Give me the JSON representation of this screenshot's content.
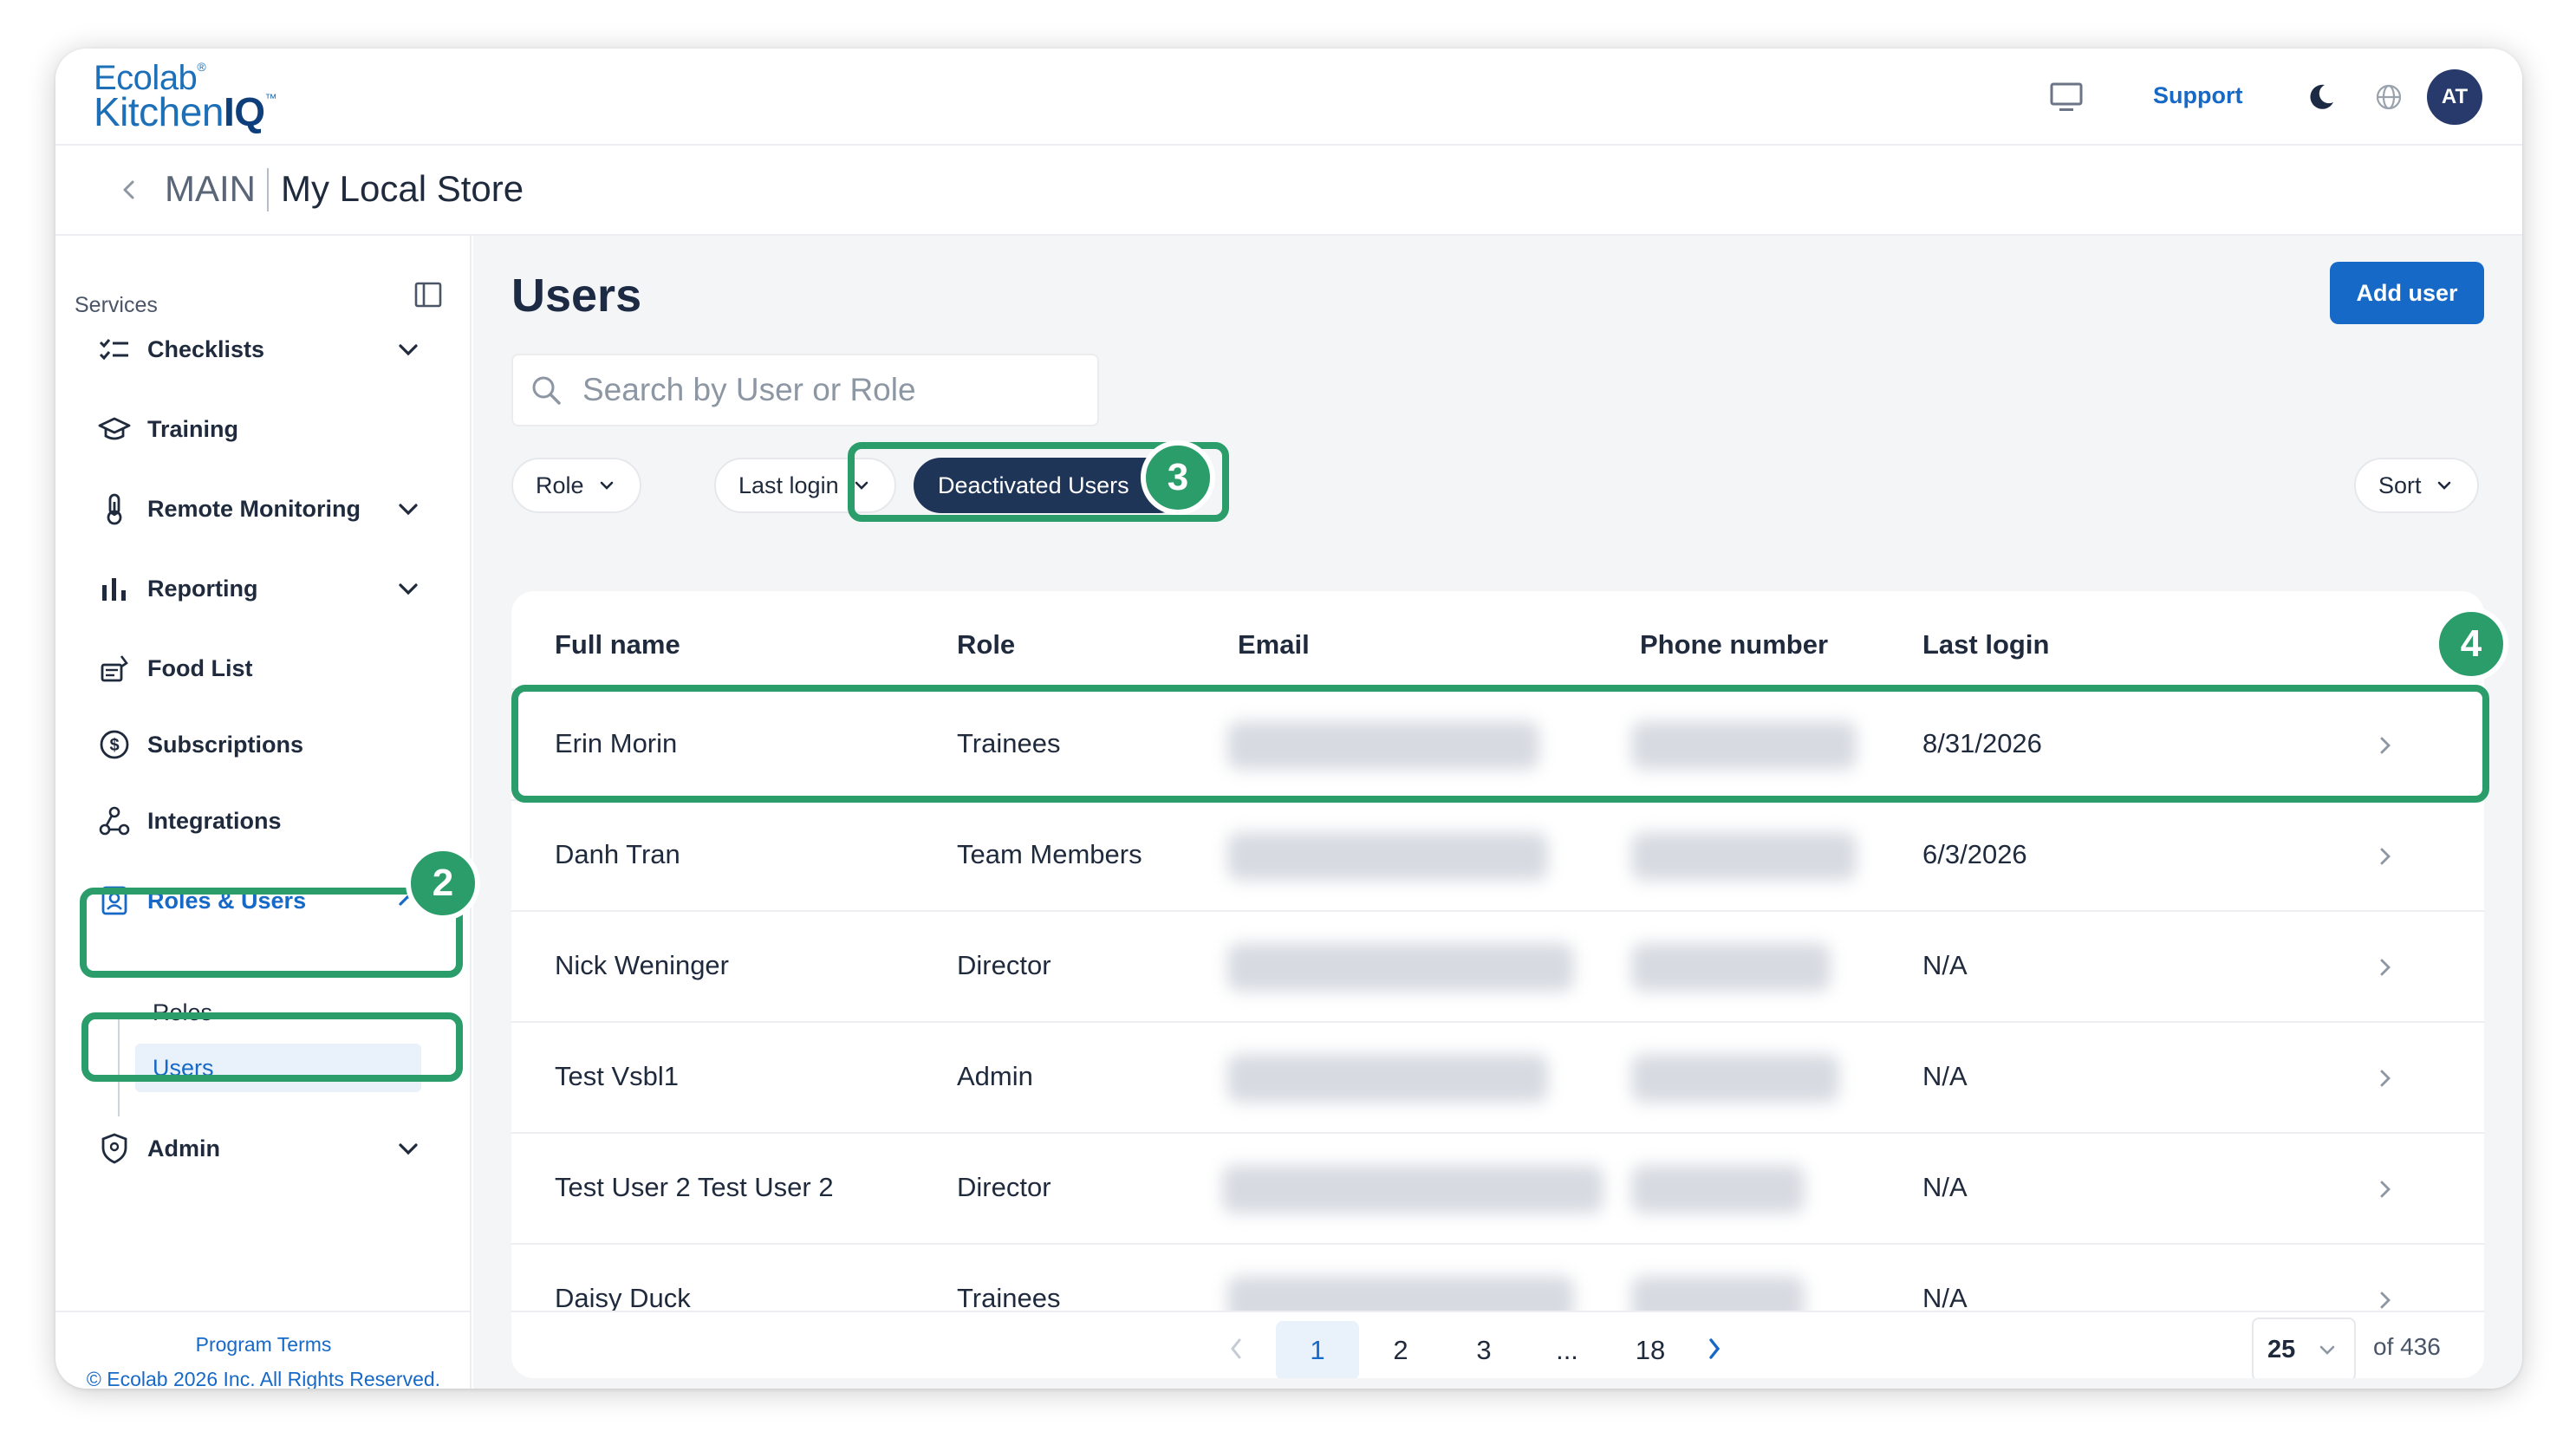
{
  "header": {
    "logo_line1": "Ecolab",
    "logo_line2": "Kitchen",
    "logo_iq": "IQ",
    "logo_reg": "®",
    "logo_tm": "™",
    "support_label": "Support",
    "avatar_initials": "AT",
    "icons": [
      "monitor-icon",
      "moon-icon",
      "globe-icon"
    ]
  },
  "breadcrumb": {
    "main": "MAIN",
    "store": "My Local Store"
  },
  "sidebar": {
    "section_label": "Services",
    "items": [
      {
        "label": "Checklists",
        "icon": "checklist-icon",
        "expandable": true
      },
      {
        "label": "Training",
        "icon": "graduation-cap-icon",
        "expandable": false
      },
      {
        "label": "Remote Monitoring",
        "icon": "thermometer-icon",
        "expandable": true
      },
      {
        "label": "Reporting",
        "icon": "bar-chart-icon",
        "expandable": true
      },
      {
        "label": "Food List",
        "icon": "food-list-icon",
        "expandable": false
      },
      {
        "label": "Subscriptions",
        "icon": "dollar-circle-icon",
        "expandable": false
      },
      {
        "label": "Integrations",
        "icon": "integrations-icon",
        "expandable": false
      },
      {
        "label": "Roles & Users",
        "icon": "id-badge-icon",
        "expandable": true,
        "expanded": true,
        "active": true
      },
      {
        "label": "Admin",
        "icon": "shield-icon",
        "expandable": true
      }
    ],
    "sub_items": [
      {
        "label": "Roles"
      },
      {
        "label": "Users",
        "active": true
      }
    ],
    "footer_link": "Program Terms",
    "footer_copyright": "© Ecolab 2026 Inc. All Rights Reserved."
  },
  "main": {
    "title": "Users",
    "add_button": "Add user",
    "search_placeholder": "Search by User or Role",
    "filters": {
      "role": "Role",
      "last_login": "Last login",
      "deactivated": "Deactivated Users",
      "sort": "Sort"
    },
    "table": {
      "columns": [
        "Full name",
        "Role",
        "Email",
        "Phone number",
        "Last login"
      ],
      "rows": [
        {
          "name": "Erin Morin",
          "role": "Trainees",
          "last_login": "8/31/2026"
        },
        {
          "name": "Danh Tran",
          "role": "Team Members",
          "last_login": "6/3/2026"
        },
        {
          "name": "Nick Weninger",
          "role": "Director",
          "last_login": "N/A"
        },
        {
          "name": "Test Vsbl1",
          "role": "Admin",
          "last_login": "N/A"
        },
        {
          "name": "Test User 2 Test User 2",
          "role": "Director",
          "last_login": "N/A"
        },
        {
          "name": "Daisy Duck",
          "role": "Trainees",
          "last_login": "N/A"
        }
      ]
    },
    "pagination": {
      "pages": [
        "1",
        "2",
        "3",
        "...",
        "18"
      ],
      "current": "1",
      "per_page": "25",
      "total": "of 436"
    }
  },
  "annotations": {
    "b2": "2",
    "b3": "3",
    "b4": "4",
    "color": "#2a9d6a"
  },
  "colors": {
    "accent": "#1769c7",
    "dark_chip": "#1f3558",
    "avatar": "#273a6b"
  }
}
